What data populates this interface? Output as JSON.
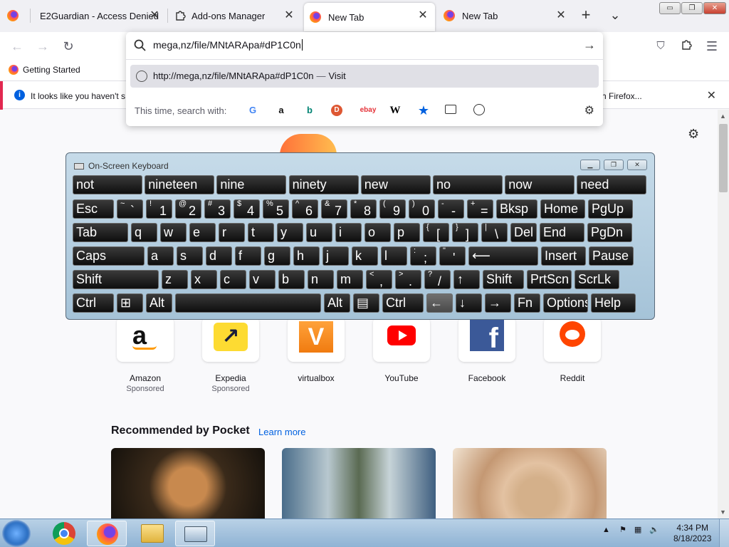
{
  "tabs": [
    {
      "title": "E2Guardian - Access Denied",
      "icon": "firefox-icon"
    },
    {
      "title": "Add-ons Manager",
      "icon": "puzzle-icon"
    },
    {
      "title": "New Tab",
      "icon": "firefox-icon",
      "selected": true
    },
    {
      "title": "New Tab",
      "icon": "firefox-icon"
    }
  ],
  "tab_close_glyph": "✕",
  "new_tab_glyph": "+",
  "list_tabs_glyph": "⌄",
  "window_controls": {
    "minimize": "▭",
    "maximize": "❐",
    "close": "✕"
  },
  "urlbar": {
    "value": "mega,nz/file/MNtARApa#dP1C0n",
    "suggestion_url": "http://mega,nz/file/MNtARApa#dP1C0n",
    "suggestion_dash": "—",
    "suggestion_action": "Visit",
    "search_with_label": "This time, search with:",
    "engines": [
      "google-icon",
      "amazon-icon",
      "bing-icon",
      "duckduckgo-icon",
      "ebay-icon",
      "wikipedia-icon",
      "bookmarks-icon",
      "tabs-icon",
      "history-icon"
    ]
  },
  "bookmarks": {
    "getting_started": "Getting Started"
  },
  "infobar": {
    "message": "It looks like you haven't s",
    "right_text": "h Firefox...",
    "info_glyph": "i",
    "close_glyph": "✕"
  },
  "osk": {
    "title": "On-Screen Keyboard",
    "predictions": [
      "not",
      "nineteen",
      "nine",
      "ninety",
      "new",
      "no",
      "now",
      "need"
    ],
    "row1": [
      {
        "main": "Esc"
      },
      {
        "sm": "~",
        "lg": "`"
      },
      {
        "sm": "!",
        "lg": "1"
      },
      {
        "sm": "@",
        "lg": "2"
      },
      {
        "sm": "#",
        "lg": "3"
      },
      {
        "sm": "$",
        "lg": "4"
      },
      {
        "sm": "%",
        "lg": "5"
      },
      {
        "sm": "^",
        "lg": "6"
      },
      {
        "sm": "&",
        "lg": "7"
      },
      {
        "sm": "*",
        "lg": "8"
      },
      {
        "sm": "(",
        "lg": "9"
      },
      {
        "sm": ")",
        "lg": "0"
      },
      {
        "sm": "-",
        "lg": "-"
      },
      {
        "sm": "+",
        "lg": "="
      },
      {
        "main": "Bksp"
      },
      {
        "main": "Home"
      },
      {
        "main": "PgUp"
      }
    ],
    "row2": [
      {
        "main": "Tab"
      },
      {
        "main": "q"
      },
      {
        "main": "w"
      },
      {
        "main": "e"
      },
      {
        "main": "r"
      },
      {
        "main": "t"
      },
      {
        "main": "y"
      },
      {
        "main": "u"
      },
      {
        "main": "i"
      },
      {
        "main": "o"
      },
      {
        "main": "p"
      },
      {
        "sm": "{",
        "lg": "["
      },
      {
        "sm": "}",
        "lg": "]"
      },
      {
        "sm": "|",
        "lg": "\\"
      },
      {
        "main": "Del"
      },
      {
        "main": "End"
      },
      {
        "main": "PgDn"
      }
    ],
    "row3": [
      {
        "main": "Caps"
      },
      {
        "main": "a"
      },
      {
        "main": "s"
      },
      {
        "main": "d"
      },
      {
        "main": "f"
      },
      {
        "main": "g"
      },
      {
        "main": "h"
      },
      {
        "main": "j"
      },
      {
        "main": "k"
      },
      {
        "main": "l"
      },
      {
        "sm": ":",
        "lg": ";"
      },
      {
        "sm": "\"",
        "lg": "'"
      },
      {
        "main": "⟵"
      },
      {
        "main": "Insert"
      },
      {
        "main": "Pause"
      }
    ],
    "row4": [
      {
        "main": "Shift"
      },
      {
        "main": "z"
      },
      {
        "main": "x"
      },
      {
        "main": "c"
      },
      {
        "main": "v"
      },
      {
        "main": "b"
      },
      {
        "main": "n"
      },
      {
        "main": "m"
      },
      {
        "sm": "<",
        "lg": ","
      },
      {
        "sm": ">",
        "lg": "."
      },
      {
        "sm": "?",
        "lg": "/"
      },
      {
        "main": "↑"
      },
      {
        "main": "Shift"
      },
      {
        "main": "PrtScn"
      },
      {
        "main": "ScrLk"
      }
    ],
    "row5": [
      {
        "main": "Ctrl"
      },
      {
        "main": "⊞"
      },
      {
        "main": "Alt"
      },
      {
        "main": ""
      },
      {
        "main": "Alt"
      },
      {
        "main": "▤"
      },
      {
        "main": "Ctrl"
      },
      {
        "main": "←"
      },
      {
        "main": "↓"
      },
      {
        "main": "→"
      },
      {
        "main": "Fn"
      },
      {
        "main": "Options"
      },
      {
        "main": "Help"
      }
    ]
  },
  "shortcuts": [
    {
      "name": "Amazon",
      "sponsored": "Sponsored",
      "icon": "amazon-icon"
    },
    {
      "name": "Expedia",
      "sponsored": "Sponsored",
      "icon": "expedia-icon"
    },
    {
      "name": "virtualbox",
      "icon": "virtualbox-icon"
    },
    {
      "name": "YouTube",
      "icon": "youtube-icon"
    },
    {
      "name": "Facebook",
      "icon": "facebook-icon"
    },
    {
      "name": "Reddit",
      "icon": "reddit-icon"
    }
  ],
  "pocket": {
    "heading": "Recommended by Pocket",
    "learn_more": "Learn more"
  },
  "taskbar": {
    "time": "4:34 PM",
    "date": "8/18/2023",
    "tray_arrow": "▲"
  },
  "colors": {
    "accent": "#0061e0",
    "osk_key": "#1a1a1a",
    "infobar_edge": "#e22850"
  }
}
